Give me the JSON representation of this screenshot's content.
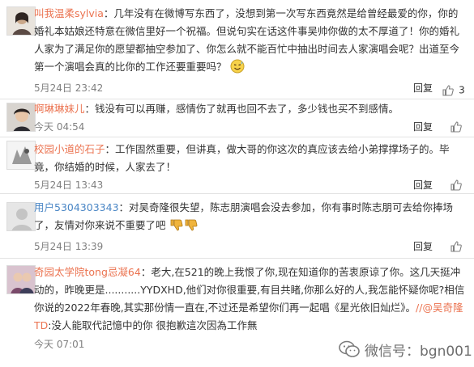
{
  "comments": [
    {
      "username": "叫我温柔sylvia",
      "content": "：几年没有在微博写东西了，没想到第一次写东西竟然是给曾经最爱的你，你的婚礼本姑娘还特意在微信里好一个祝福。但说句实在话这件事吴帅你做的太不厚道了！你的婚礼人家为了满足你的愿望都抽空参加了、你怎么就不能百忙中抽出时间去人家演唱会呢？出道至今第一个演唱会真的比你的工作还要重要吗？",
      "time": "5月24日 23:42",
      "reply": "回复",
      "likes": "3"
    },
    {
      "username": "啊琳琳妹儿",
      "content": "：钱没有可以再赚，感情伤了就再也回不去了，多少钱也买不到感情。",
      "time": "今天 04:54",
      "reply": "回复",
      "likes": ""
    },
    {
      "username": "校园小道的石子",
      "content": "：工作固然重要，但讲真，做大哥的你这次的真应该去给小弟撑撑场子的。毕竟，你结婚的时候，人家去了！",
      "time": "5月24日 13:43",
      "reply": "回复",
      "likes": ""
    },
    {
      "username": "用户5304303343",
      "content": "：对吴奇隆很失望，陈志朋演唱会没去参加，你有事时陈志朋可去给你捧场了，友情对你来说不重要了吧",
      "time": "5月24日 13:39",
      "reply": "回复",
      "likes": ""
    },
    {
      "username": "奇园太学院tong忌凝64",
      "content_1": "：老大,在521的晚上我恨了你,现在知道你的苦衷原谅了你。这几天挺冲动的，昨晚更是...........YYDXHD,他们对你很重要,有目共睹,你那么好的人,我怎能怀疑你呢?相信你说的2022年春晚,其实那份情一直在,不过还是希望你们再一起唱《星光依旧灿烂》。",
      "mention": "//@吴奇隆TD",
      "content_2": ":没人能取代記憶中的你 很抱歉這次因為工作無",
      "time": "今天 07:01",
      "reply": "回复",
      "likes": ""
    }
  ],
  "watermark": {
    "text": "微信号：bgn001"
  },
  "icons": {
    "like": "thumbs-up-icon",
    "emoji_1": "sweat-smile-emoji",
    "emoji_2": "thumbs-down-emoji"
  }
}
